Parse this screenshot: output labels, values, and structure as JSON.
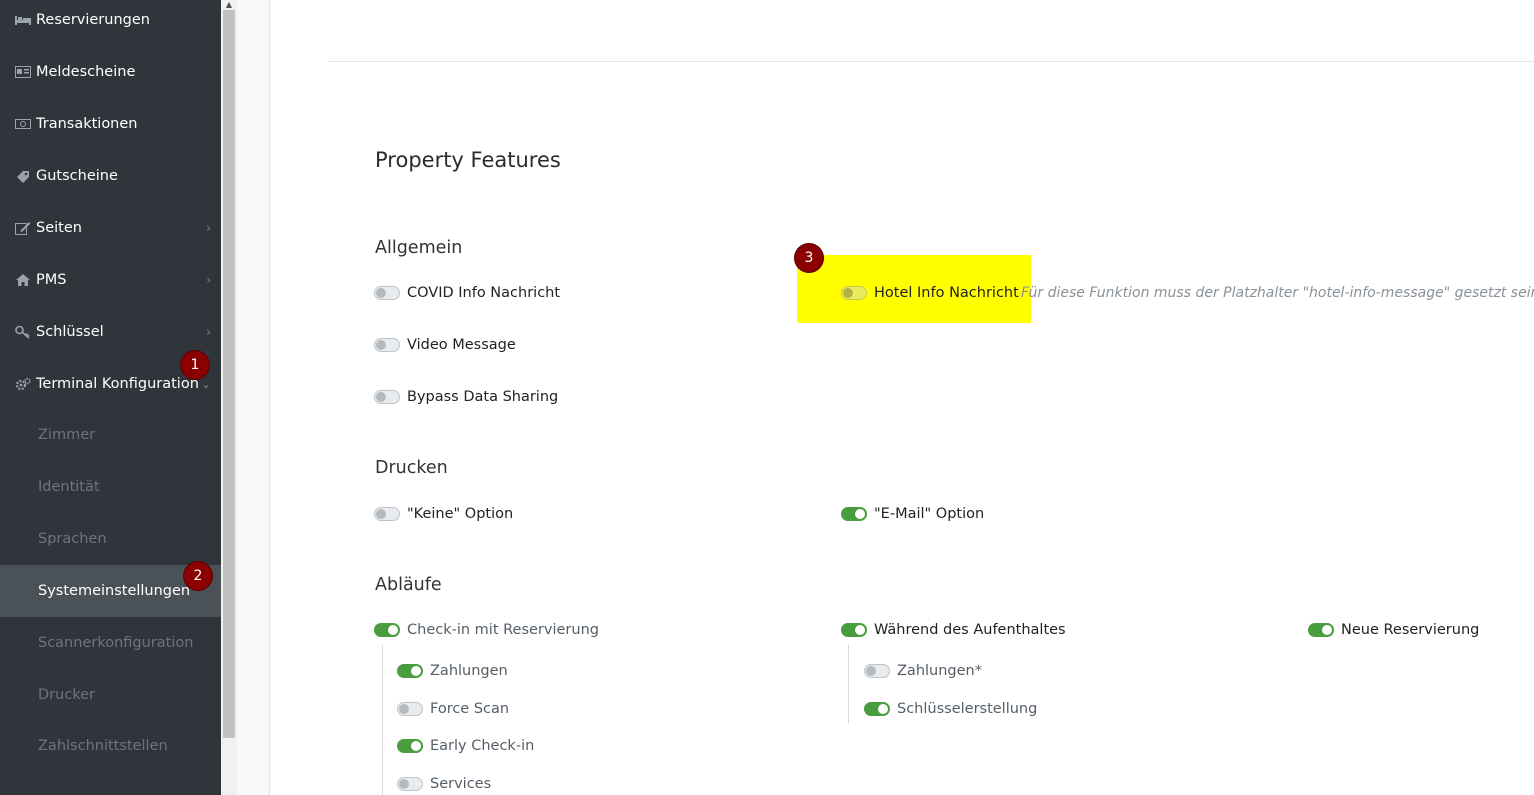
{
  "sidebar": {
    "items": [
      {
        "label": "Reservierungen",
        "icon": "bed-icon"
      },
      {
        "label": "Meldescheine",
        "icon": "id-card-icon"
      },
      {
        "label": "Transaktionen",
        "icon": "money-icon"
      },
      {
        "label": "Gutscheine",
        "icon": "ticket-icon"
      },
      {
        "label": "Seiten",
        "icon": "edit-icon"
      },
      {
        "label": "PMS",
        "icon": "home-icon"
      },
      {
        "label": "Schlüssel",
        "icon": "key-icon"
      },
      {
        "label": "Terminal Konfiguration",
        "icon": "cogs-icon"
      }
    ],
    "subitems": [
      {
        "label": "Zimmer"
      },
      {
        "label": "Identität"
      },
      {
        "label": "Sprachen"
      },
      {
        "label": "Systemeinstellungen"
      },
      {
        "label": "Scannerkonfiguration"
      },
      {
        "label": "Drucker"
      },
      {
        "label": "Zahlschnittstellen"
      }
    ],
    "chevron": "›",
    "chevron_open": "⌄"
  },
  "badges": {
    "one": "1",
    "two": "2",
    "three": "3"
  },
  "main": {
    "title": "Property Features",
    "sections": {
      "allgemein": "Allgemein",
      "drucken": "Drucken",
      "ablaeufe": "Abläufe"
    },
    "allgemein": {
      "covid": "COVID Info Nachricht",
      "video": "Video Message",
      "bypass": "Bypass Data Sharing",
      "hotel": "Hotel Info Nachricht",
      "hotel_hint": "Für diese Funktion muss der Platzhalter \"hotel-info-message\" gesetzt sein"
    },
    "drucken": {
      "keine": "\"Keine\" Option",
      "email": "\"E-Mail\" Option"
    },
    "ablaeufe": {
      "checkin": "Check-in mit Reservierung",
      "zahlungen": "Zahlungen",
      "force_scan": "Force Scan",
      "early": "Early Check-in",
      "services": "Services",
      "waehrend": "Während des Aufenthaltes",
      "zahlungen_star": "Zahlungen*",
      "schluessel": "Schlüsselerstellung",
      "neue": "Neue Reservierung"
    }
  },
  "colors": {
    "accent_green": "#4a9d3e",
    "highlight": "#ffff00",
    "badge": "#8b0000",
    "sidebar": "#2f353b"
  }
}
